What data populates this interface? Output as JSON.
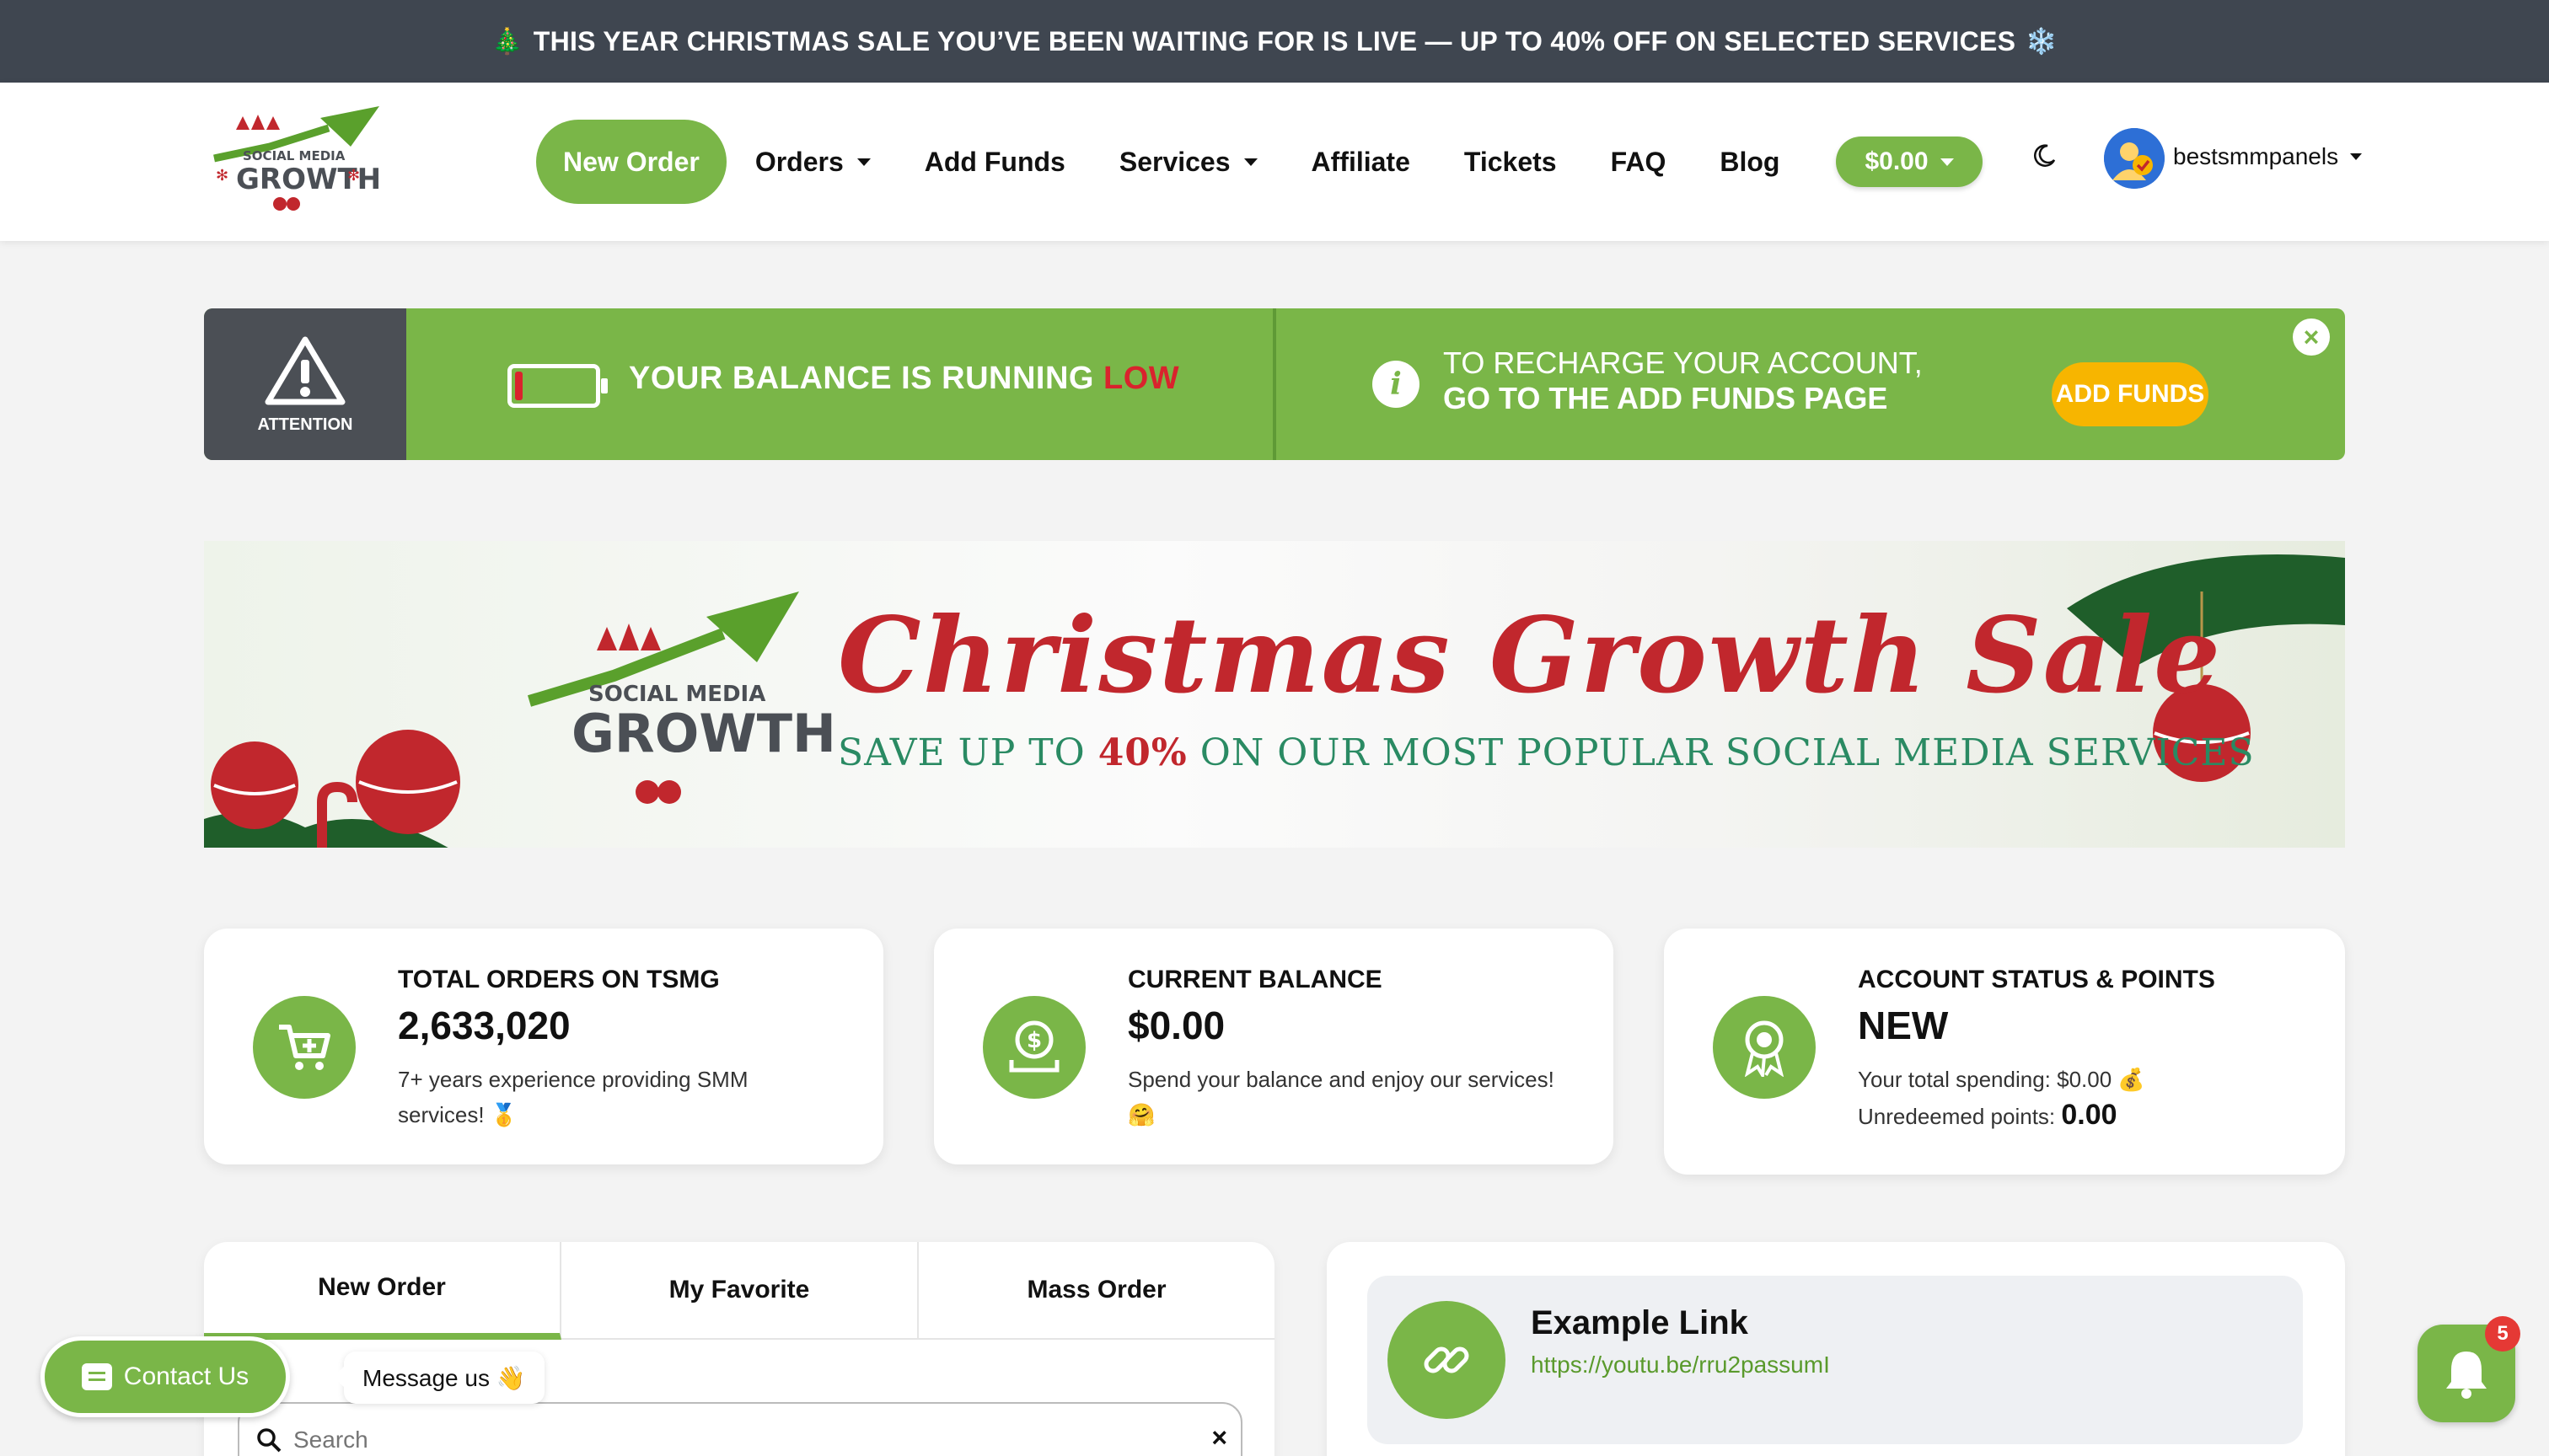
{
  "announcement": {
    "text": "THIS YEAR CHRISTMAS SALE YOU’VE BEEN WAITING FOR IS LIVE — UP TO 40% OFF ON SELECTED SERVICES",
    "left_emoji": "🎄",
    "right_emoji": "❄️"
  },
  "header": {
    "logo_alt": "Social Media Growth",
    "logo_line1": "SOCIAL MEDIA",
    "logo_line2": "GROWTH",
    "nav": [
      {
        "label": "New Order",
        "active": true,
        "dropdown": false
      },
      {
        "label": "Orders",
        "active": false,
        "dropdown": true
      },
      {
        "label": "Add Funds",
        "active": false,
        "dropdown": false
      },
      {
        "label": "Services",
        "active": false,
        "dropdown": true
      },
      {
        "label": "Affiliate",
        "active": false,
        "dropdown": false
      },
      {
        "label": "Tickets",
        "active": false,
        "dropdown": false
      },
      {
        "label": "FAQ",
        "active": false,
        "dropdown": false
      },
      {
        "label": "Blog",
        "active": false,
        "dropdown": false
      }
    ],
    "balance": "$0.00",
    "username": "bestsmmpanels",
    "theme_icon": "moon-icon"
  },
  "alert": {
    "attention_label": "ATTENTION",
    "message_prefix": "YOUR BALANCE IS RUNNING ",
    "message_emphasis": "LOW",
    "battery_level": 0.1,
    "recharge_line1": "TO RECHARGE YOUR ACCOUNT,",
    "recharge_line2": "GO TO THE ADD FUNDS PAGE",
    "button": "ADD FUNDS",
    "close": "×"
  },
  "banner": {
    "title": "Christmas Growth Sale",
    "subtitle_prefix": "SAVE UP TO ",
    "subtitle_pct": "40%",
    "subtitle_suffix": " ON OUR MOST POPULAR SOCIAL MEDIA SERVICES"
  },
  "stats": [
    {
      "label": "TOTAL ORDERS ON TSMG",
      "value": "2,633,020",
      "desc": "7+ years experience providing SMM services! 🥇",
      "icon": "cart-icon"
    },
    {
      "label": "CURRENT BALANCE",
      "value": "$0.00",
      "desc": "Spend your balance and enjoy our services! 🤗",
      "icon": "money-icon"
    },
    {
      "label": "ACCOUNT STATUS & POINTS",
      "value": "NEW",
      "spending_label": "Your total spending: ",
      "spending_value": "$0.00 💰",
      "points_label": "Unredeemed points: ",
      "points_value": "0.00",
      "icon": "award-icon"
    }
  ],
  "order_tabs": [
    {
      "label": "New Order",
      "active": true
    },
    {
      "label": "My Favorite",
      "active": false
    },
    {
      "label": "Mass Order",
      "active": false
    }
  ],
  "search": {
    "placeholder": "Search",
    "clear": "×"
  },
  "example_link": {
    "title": "Example Link",
    "url": "https://youtu.be/rru2passumI"
  },
  "contact": {
    "label": "Contact Us",
    "bubble": "Message us 👋"
  },
  "notifications": {
    "count": "5"
  },
  "colors": {
    "brand_green": "#7ab648",
    "topbar": "#3f4650",
    "alert_dark": "#4b4f55",
    "cta_yellow": "#f7b500",
    "sale_red": "#c1272d",
    "sale_green": "#2a8a63"
  }
}
